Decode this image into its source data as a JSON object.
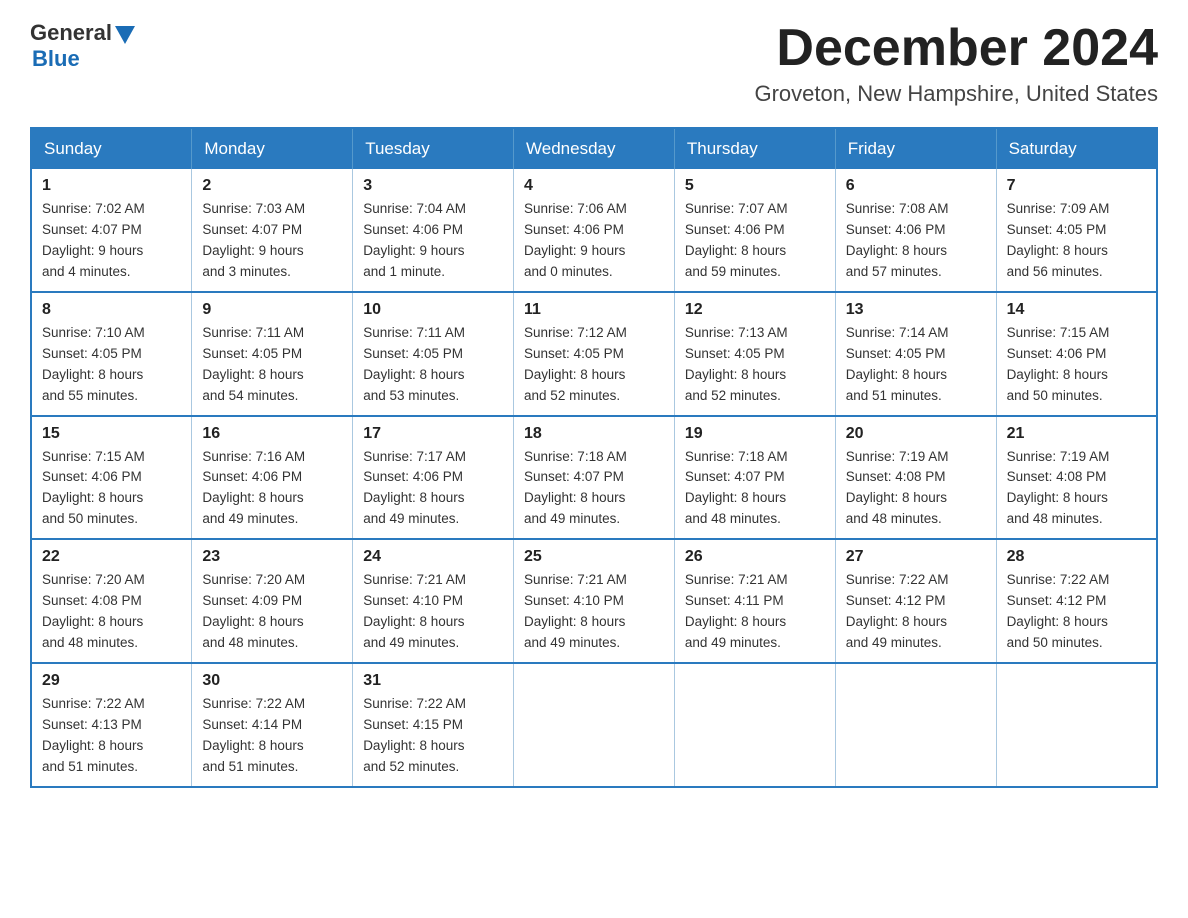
{
  "header": {
    "logo_general": "General",
    "logo_blue": "Blue",
    "month_title": "December 2024",
    "location": "Groveton, New Hampshire, United States"
  },
  "weekdays": [
    "Sunday",
    "Monday",
    "Tuesday",
    "Wednesday",
    "Thursday",
    "Friday",
    "Saturday"
  ],
  "weeks": [
    [
      {
        "day": "1",
        "info": "Sunrise: 7:02 AM\nSunset: 4:07 PM\nDaylight: 9 hours\nand 4 minutes."
      },
      {
        "day": "2",
        "info": "Sunrise: 7:03 AM\nSunset: 4:07 PM\nDaylight: 9 hours\nand 3 minutes."
      },
      {
        "day": "3",
        "info": "Sunrise: 7:04 AM\nSunset: 4:06 PM\nDaylight: 9 hours\nand 1 minute."
      },
      {
        "day": "4",
        "info": "Sunrise: 7:06 AM\nSunset: 4:06 PM\nDaylight: 9 hours\nand 0 minutes."
      },
      {
        "day": "5",
        "info": "Sunrise: 7:07 AM\nSunset: 4:06 PM\nDaylight: 8 hours\nand 59 minutes."
      },
      {
        "day": "6",
        "info": "Sunrise: 7:08 AM\nSunset: 4:06 PM\nDaylight: 8 hours\nand 57 minutes."
      },
      {
        "day": "7",
        "info": "Sunrise: 7:09 AM\nSunset: 4:05 PM\nDaylight: 8 hours\nand 56 minutes."
      }
    ],
    [
      {
        "day": "8",
        "info": "Sunrise: 7:10 AM\nSunset: 4:05 PM\nDaylight: 8 hours\nand 55 minutes."
      },
      {
        "day": "9",
        "info": "Sunrise: 7:11 AM\nSunset: 4:05 PM\nDaylight: 8 hours\nand 54 minutes."
      },
      {
        "day": "10",
        "info": "Sunrise: 7:11 AM\nSunset: 4:05 PM\nDaylight: 8 hours\nand 53 minutes."
      },
      {
        "day": "11",
        "info": "Sunrise: 7:12 AM\nSunset: 4:05 PM\nDaylight: 8 hours\nand 52 minutes."
      },
      {
        "day": "12",
        "info": "Sunrise: 7:13 AM\nSunset: 4:05 PM\nDaylight: 8 hours\nand 52 minutes."
      },
      {
        "day": "13",
        "info": "Sunrise: 7:14 AM\nSunset: 4:05 PM\nDaylight: 8 hours\nand 51 minutes."
      },
      {
        "day": "14",
        "info": "Sunrise: 7:15 AM\nSunset: 4:06 PM\nDaylight: 8 hours\nand 50 minutes."
      }
    ],
    [
      {
        "day": "15",
        "info": "Sunrise: 7:15 AM\nSunset: 4:06 PM\nDaylight: 8 hours\nand 50 minutes."
      },
      {
        "day": "16",
        "info": "Sunrise: 7:16 AM\nSunset: 4:06 PM\nDaylight: 8 hours\nand 49 minutes."
      },
      {
        "day": "17",
        "info": "Sunrise: 7:17 AM\nSunset: 4:06 PM\nDaylight: 8 hours\nand 49 minutes."
      },
      {
        "day": "18",
        "info": "Sunrise: 7:18 AM\nSunset: 4:07 PM\nDaylight: 8 hours\nand 49 minutes."
      },
      {
        "day": "19",
        "info": "Sunrise: 7:18 AM\nSunset: 4:07 PM\nDaylight: 8 hours\nand 48 minutes."
      },
      {
        "day": "20",
        "info": "Sunrise: 7:19 AM\nSunset: 4:08 PM\nDaylight: 8 hours\nand 48 minutes."
      },
      {
        "day": "21",
        "info": "Sunrise: 7:19 AM\nSunset: 4:08 PM\nDaylight: 8 hours\nand 48 minutes."
      }
    ],
    [
      {
        "day": "22",
        "info": "Sunrise: 7:20 AM\nSunset: 4:08 PM\nDaylight: 8 hours\nand 48 minutes."
      },
      {
        "day": "23",
        "info": "Sunrise: 7:20 AM\nSunset: 4:09 PM\nDaylight: 8 hours\nand 48 minutes."
      },
      {
        "day": "24",
        "info": "Sunrise: 7:21 AM\nSunset: 4:10 PM\nDaylight: 8 hours\nand 49 minutes."
      },
      {
        "day": "25",
        "info": "Sunrise: 7:21 AM\nSunset: 4:10 PM\nDaylight: 8 hours\nand 49 minutes."
      },
      {
        "day": "26",
        "info": "Sunrise: 7:21 AM\nSunset: 4:11 PM\nDaylight: 8 hours\nand 49 minutes."
      },
      {
        "day": "27",
        "info": "Sunrise: 7:22 AM\nSunset: 4:12 PM\nDaylight: 8 hours\nand 49 minutes."
      },
      {
        "day": "28",
        "info": "Sunrise: 7:22 AM\nSunset: 4:12 PM\nDaylight: 8 hours\nand 50 minutes."
      }
    ],
    [
      {
        "day": "29",
        "info": "Sunrise: 7:22 AM\nSunset: 4:13 PM\nDaylight: 8 hours\nand 51 minutes."
      },
      {
        "day": "30",
        "info": "Sunrise: 7:22 AM\nSunset: 4:14 PM\nDaylight: 8 hours\nand 51 minutes."
      },
      {
        "day": "31",
        "info": "Sunrise: 7:22 AM\nSunset: 4:15 PM\nDaylight: 8 hours\nand 52 minutes."
      },
      {
        "day": "",
        "info": ""
      },
      {
        "day": "",
        "info": ""
      },
      {
        "day": "",
        "info": ""
      },
      {
        "day": "",
        "info": ""
      }
    ]
  ]
}
